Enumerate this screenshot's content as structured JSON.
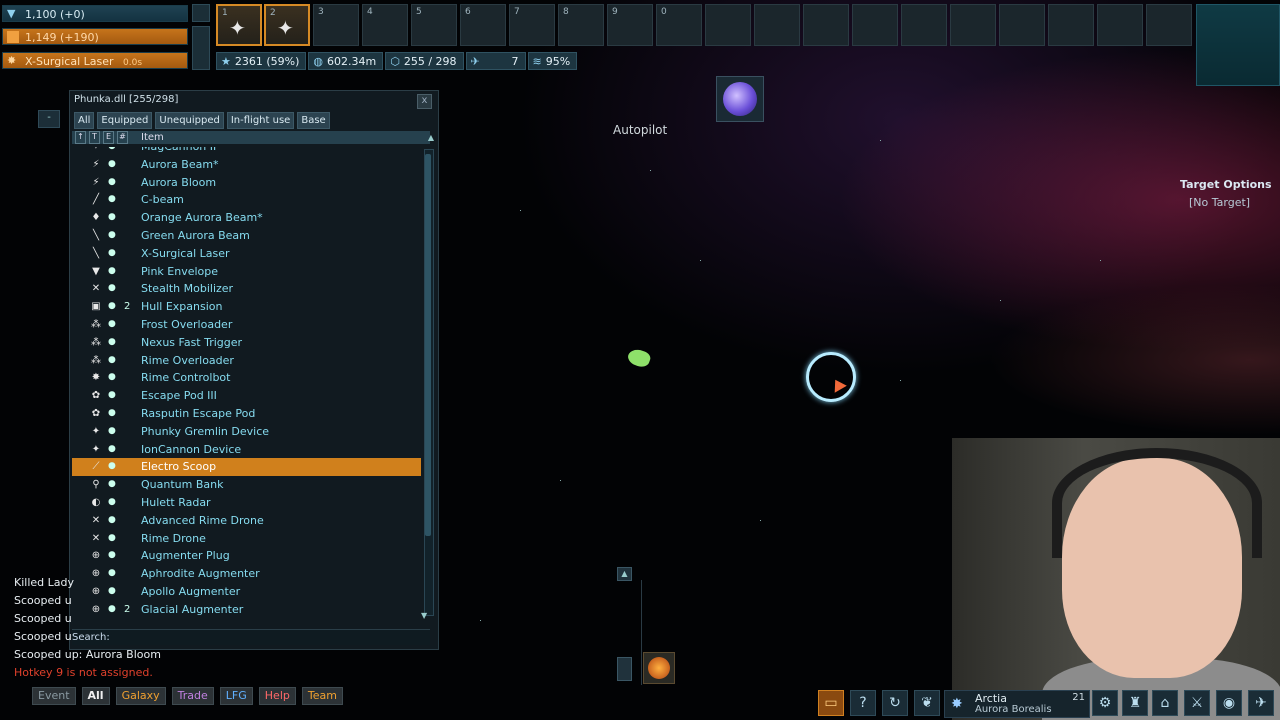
{
  "status": {
    "shield": "1,100 (+0)",
    "energy": "1,149 (+190)",
    "weapon": "X-Surgical Laser",
    "weapon_timer": "0.0s"
  },
  "hotbar": {
    "slots": [
      "1",
      "2",
      "3",
      "4",
      "5",
      "6",
      "7",
      "8",
      "9",
      "0"
    ]
  },
  "stats": {
    "xp": "2361 (59%)",
    "distance": "602.34m",
    "cargo": "255 / 298",
    "speed": "7",
    "efficiency": "95%"
  },
  "inventory": {
    "title": "Phunka.dll [255/298]",
    "close": "x",
    "filters": [
      "All",
      "Equipped",
      "Unequipped",
      "In-flight use",
      "Base"
    ],
    "header_label": "Item",
    "header_buttons": [
      "↑",
      "T",
      "E",
      "#"
    ],
    "search_label": "Search:",
    "items": [
      {
        "name": "MagCannon II",
        "icon": "✦",
        "eq": "●",
        "count": ""
      },
      {
        "name": "Aurora Beam*",
        "icon": "⚡",
        "eq": "●",
        "count": ""
      },
      {
        "name": "Aurora Bloom",
        "icon": "⚡",
        "eq": "●",
        "count": ""
      },
      {
        "name": "C-beam",
        "icon": "╱",
        "eq": "●",
        "count": ""
      },
      {
        "name": "Orange Aurora Beam*",
        "icon": "♦",
        "eq": "●",
        "count": ""
      },
      {
        "name": "Green Aurora Beam",
        "icon": "╲",
        "eq": "●",
        "count": ""
      },
      {
        "name": "X-Surgical Laser",
        "icon": "╲",
        "eq": "●",
        "count": ""
      },
      {
        "name": "Pink Envelope",
        "icon": "▼",
        "eq": "●",
        "count": ""
      },
      {
        "name": "Stealth Mobilizer",
        "icon": "✕",
        "eq": "●",
        "count": ""
      },
      {
        "name": "Hull Expansion",
        "icon": "▣",
        "eq": "●",
        "count": "2"
      },
      {
        "name": "Frost Overloader",
        "icon": "⁂",
        "eq": "●",
        "count": ""
      },
      {
        "name": "Nexus Fast Trigger",
        "icon": "⁂",
        "eq": "●",
        "count": ""
      },
      {
        "name": "Rime Overloader",
        "icon": "⁂",
        "eq": "●",
        "count": ""
      },
      {
        "name": "Rime Controlbot",
        "icon": "✸",
        "eq": "●",
        "count": ""
      },
      {
        "name": "Escape Pod III",
        "icon": "✿",
        "eq": "●",
        "count": ""
      },
      {
        "name": "Rasputin Escape Pod",
        "icon": "✿",
        "eq": "●",
        "count": ""
      },
      {
        "name": "Phunky Gremlin Device",
        "icon": "✦",
        "eq": "●",
        "count": ""
      },
      {
        "name": "IonCannon Device",
        "icon": "✦",
        "eq": "●",
        "count": ""
      },
      {
        "name": "Electro Scoop",
        "icon": "⟋",
        "eq": "●",
        "count": ""
      },
      {
        "name": "Quantum Bank",
        "icon": "⚲",
        "eq": "●",
        "count": ""
      },
      {
        "name": "Hulett Radar",
        "icon": "◐",
        "eq": "●",
        "count": ""
      },
      {
        "name": "Advanced Rime Drone",
        "icon": "✕",
        "eq": "●",
        "count": ""
      },
      {
        "name": "Rime Drone",
        "icon": "✕",
        "eq": "●",
        "count": ""
      },
      {
        "name": "Augmenter Plug",
        "icon": "⊕",
        "eq": "●",
        "count": ""
      },
      {
        "name": "Aphrodite Augmenter",
        "icon": "⊕",
        "eq": "●",
        "count": ""
      },
      {
        "name": "Apollo Augmenter",
        "icon": "⊕",
        "eq": "●",
        "count": ""
      },
      {
        "name": "Glacial Augmenter",
        "icon": "⊕",
        "eq": "●",
        "count": "2"
      }
    ],
    "selected": "Electro Scoop"
  },
  "log": [
    "Killed Lady",
    "Scooped u",
    "Scooped u",
    "Scooped u",
    "Scooped up: Aurora Bloom"
  ],
  "log_error": "Hotkey 9 is not assigned.",
  "chat_tabs": [
    "Event",
    "All",
    "Galaxy",
    "Trade",
    "LFG",
    "Help",
    "Team"
  ],
  "hud": {
    "autopilot": "Autopilot",
    "target_title": "Target Options",
    "target_sub": "[No Target]"
  },
  "location": {
    "system": "Arctia",
    "region": "Aurora Borealis",
    "level": "21"
  },
  "colors": {
    "accent": "#d0801c",
    "item_text": "#86dcf0",
    "error": "#e0412c"
  }
}
